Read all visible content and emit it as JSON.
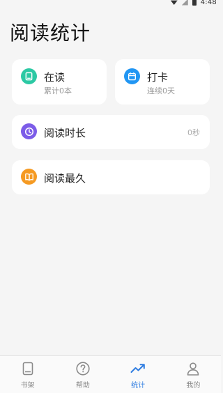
{
  "status_bar": {
    "time": "4:48"
  },
  "page_title": "阅读统计",
  "cards": {
    "reading": {
      "title": "在读",
      "subtitle": "累计0本",
      "icon": "book-icon",
      "color": "#2cc9a4"
    },
    "checkin": {
      "title": "打卡",
      "subtitle": "连续0天",
      "icon": "calendar-icon",
      "color": "#2196f3"
    },
    "duration": {
      "title": "阅读时长",
      "value": "0秒",
      "icon": "clock-icon",
      "color": "#7c5ce8"
    },
    "longest": {
      "title": "阅读最久",
      "icon": "open-book-icon",
      "color": "#f59a22"
    }
  },
  "bottom_nav": {
    "items": [
      {
        "label": "书架",
        "icon": "bookshelf-icon",
        "active": false
      },
      {
        "label": "帮助",
        "icon": "help-icon",
        "active": false
      },
      {
        "label": "统计",
        "icon": "trend-icon",
        "active": true
      },
      {
        "label": "我的",
        "icon": "person-icon",
        "active": false
      }
    ],
    "active_color": "#2f7de1"
  }
}
